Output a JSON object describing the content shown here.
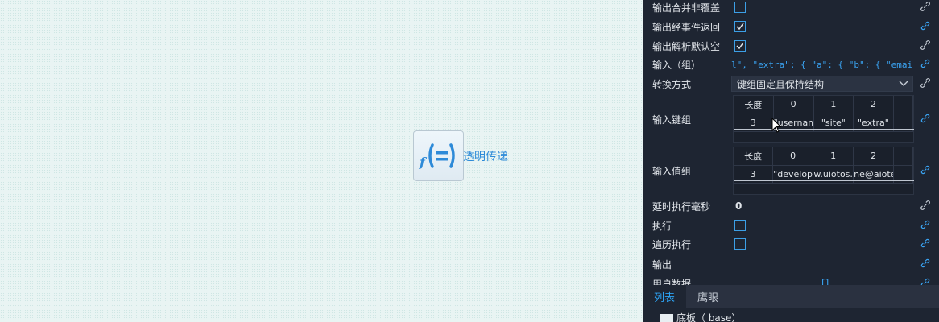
{
  "canvas": {
    "node_label": "透明传递",
    "node_icon": "function-equal-icon"
  },
  "panel": {
    "rows": {
      "merge": {
        "label": "输出合并非覆盖",
        "checked": false
      },
      "event_return": {
        "label": "输出经事件返回",
        "checked": true
      },
      "parse_default": {
        "label": "输出解析默认空",
        "checked": true
      },
      "input_group": {
        "label": "输入（组）",
        "value": "l\",   \"extra\": {     \"a\": {       \"b\": {         \"email\""
      },
      "convert_mode": {
        "label": "转换方式",
        "value": "键组固定且保持结构"
      },
      "input_keys": {
        "label": "输入键组",
        "header": [
          "长度",
          "0",
          "1",
          "2",
          ""
        ],
        "row": [
          "3",
          "\"username",
          "\"site\"",
          "\"extra\"",
          ""
        ]
      },
      "input_values": {
        "label": "输入值组",
        "header": [
          "长度",
          "0",
          "1",
          "2",
          ""
        ],
        "row": [
          "3",
          "\"develop\"",
          "w.uiotos.",
          "ne@aiote",
          ""
        ]
      },
      "delay": {
        "label": "延时执行毫秒",
        "value": "0"
      },
      "execute": {
        "label": "执行",
        "checked": false
      },
      "iterate": {
        "label": "遍历执行",
        "checked": false
      },
      "output": {
        "label": "输出"
      },
      "user_data": {
        "label": "用户数据",
        "value": "[]"
      }
    },
    "tabs": [
      "列表",
      "鹰眼"
    ],
    "active_tab": "列表",
    "tree": {
      "label": "底板（ base）"
    }
  },
  "colors": {
    "panel_bg": "#1e2532",
    "accent": "#2da4f5",
    "canvas_bg": "#e9f4f3"
  }
}
